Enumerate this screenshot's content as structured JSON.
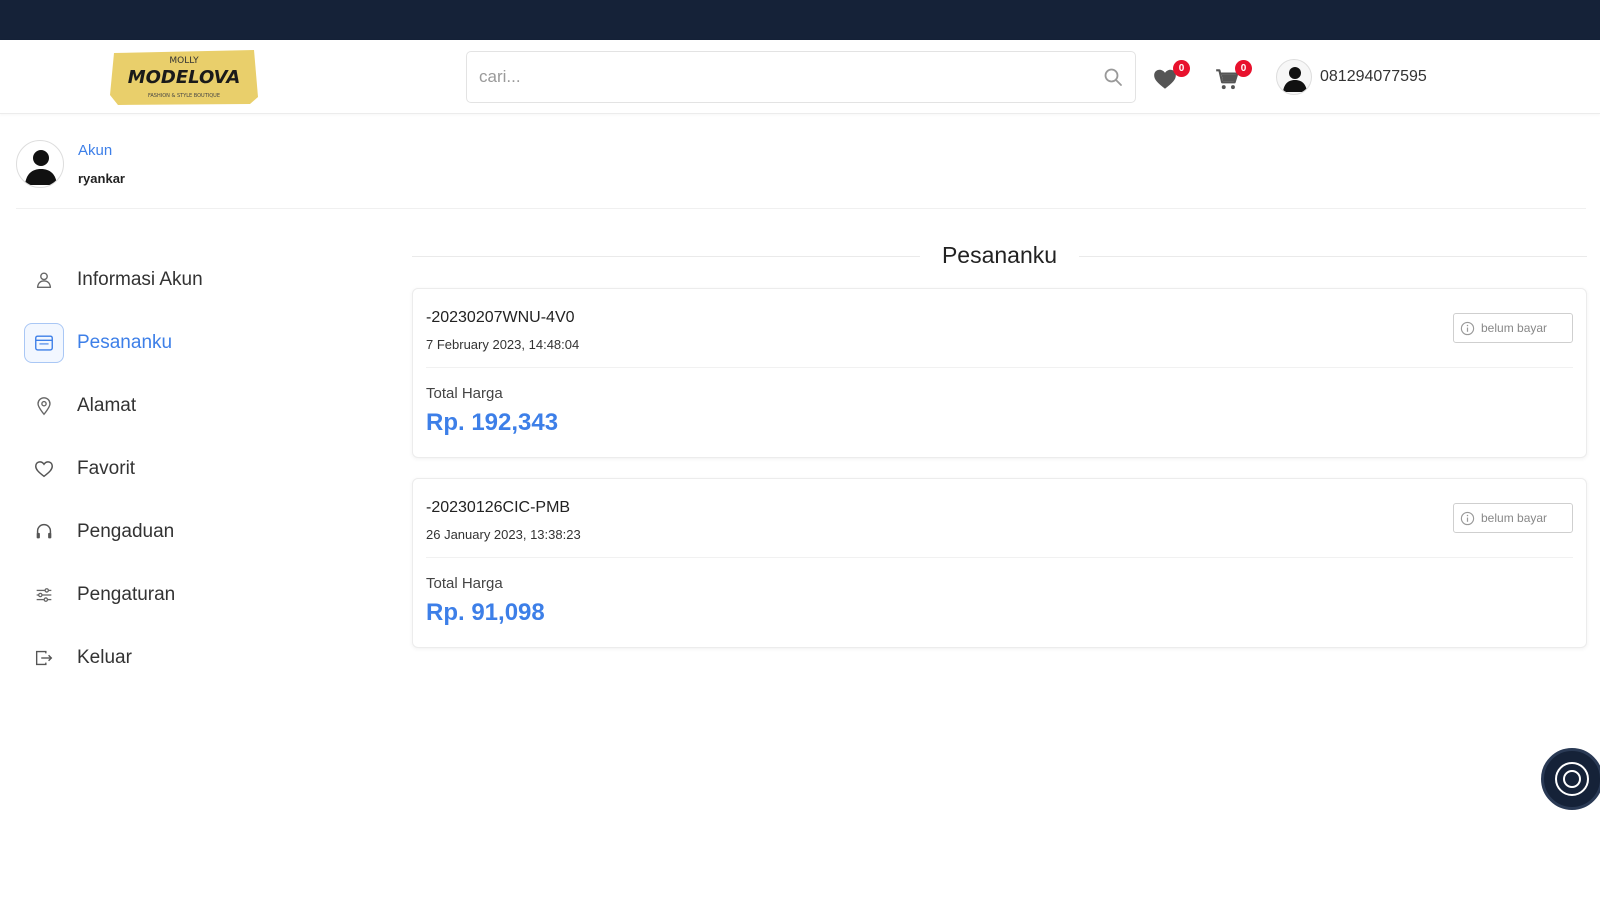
{
  "brand": {
    "logo_top": "MOLLY",
    "logo_main": "MODELOVA",
    "logo_sub": "FASHION & STYLE BOUTIQUE"
  },
  "search": {
    "placeholder": "cari...",
    "value": ""
  },
  "header": {
    "wishlist_count": "0",
    "cart_count": "0",
    "phone": "081294077595"
  },
  "profile": {
    "label": "Akun",
    "username": "ryankar"
  },
  "sidebar": {
    "items": [
      {
        "label": "Informasi Akun",
        "icon": "user-icon",
        "active": false
      },
      {
        "label": "Pesananku",
        "icon": "orders-icon",
        "active": true
      },
      {
        "label": "Alamat",
        "icon": "map-pin-icon",
        "active": false
      },
      {
        "label": "Favorit",
        "icon": "heart-icon",
        "active": false
      },
      {
        "label": "Pengaduan",
        "icon": "headset-icon",
        "active": false
      },
      {
        "label": "Pengaturan",
        "icon": "sliders-icon",
        "active": false
      },
      {
        "label": "Keluar",
        "icon": "logout-icon",
        "active": false
      }
    ]
  },
  "main": {
    "title": "Pesananku",
    "orders": [
      {
        "id": "-20230207WNU-4V0",
        "date": "7 February 2023, 14:48:04",
        "total_label": "Total Harga",
        "total": "Rp. 192,343",
        "status": "belum bayar"
      },
      {
        "id": "-20230126CIC-PMB",
        "date": "26 January 2023, 13:38:23",
        "total_label": "Total Harga",
        "total": "Rp. 91,098",
        "status": "belum bayar"
      }
    ]
  },
  "colors": {
    "topbar": "#152238",
    "accent": "#3d7fe8",
    "badge": "#e8112d",
    "logo_bg": "#e9cf6b"
  }
}
